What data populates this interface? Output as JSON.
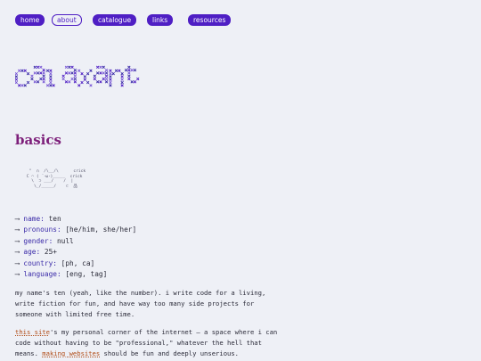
{
  "nav": {
    "items": [
      {
        "label": "home"
      },
      {
        "label": "about"
      },
      {
        "label": "catalogue"
      },
      {
        "label": "links"
      },
      {
        "label": "resources"
      }
    ],
    "active_index": 1
  },
  "logo": {
    "wordmark": "calaxant"
  },
  "section": {
    "title": "basics"
  },
  "ascii": {
    "art": "  \"  ∩  /\\__/\\      crick\n C ⌒ ( ´･ω･)_____  crick\n   \\  ⊃ ___/    /  |\n    \\_/_____/    ⊂  品"
  },
  "facts": {
    "arrow": "⟶",
    "items": [
      {
        "key": "name:",
        "value": "ten"
      },
      {
        "key": "pronouns:",
        "value": "[he/him, she/her]"
      },
      {
        "key": "gender:",
        "value": "null"
      },
      {
        "key": "age:",
        "value": "25+"
      },
      {
        "key": "country:",
        "value": "[ph, ca]"
      },
      {
        "key": "language:",
        "value": "[eng, tag]"
      }
    ]
  },
  "intro": {
    "p1": "my name's ten (yeah, like the number). i write code for a living, write fiction for fun, and have way too many side projects for someone with limited free time.",
    "p2_link1": "this site",
    "p2_mid": "'s my personal corner of the internet — a space where i can code without having to be \"professional,\" whatever the hell that means. ",
    "p2_link2": "making websites",
    "p2_end": " should be fun and deeply unserious."
  },
  "colors": {
    "accent": "#4f1fc4",
    "heading": "#7d1f7a",
    "background": "#eef0f6",
    "link": "#b04a14",
    "key": "#3a2aa8"
  }
}
